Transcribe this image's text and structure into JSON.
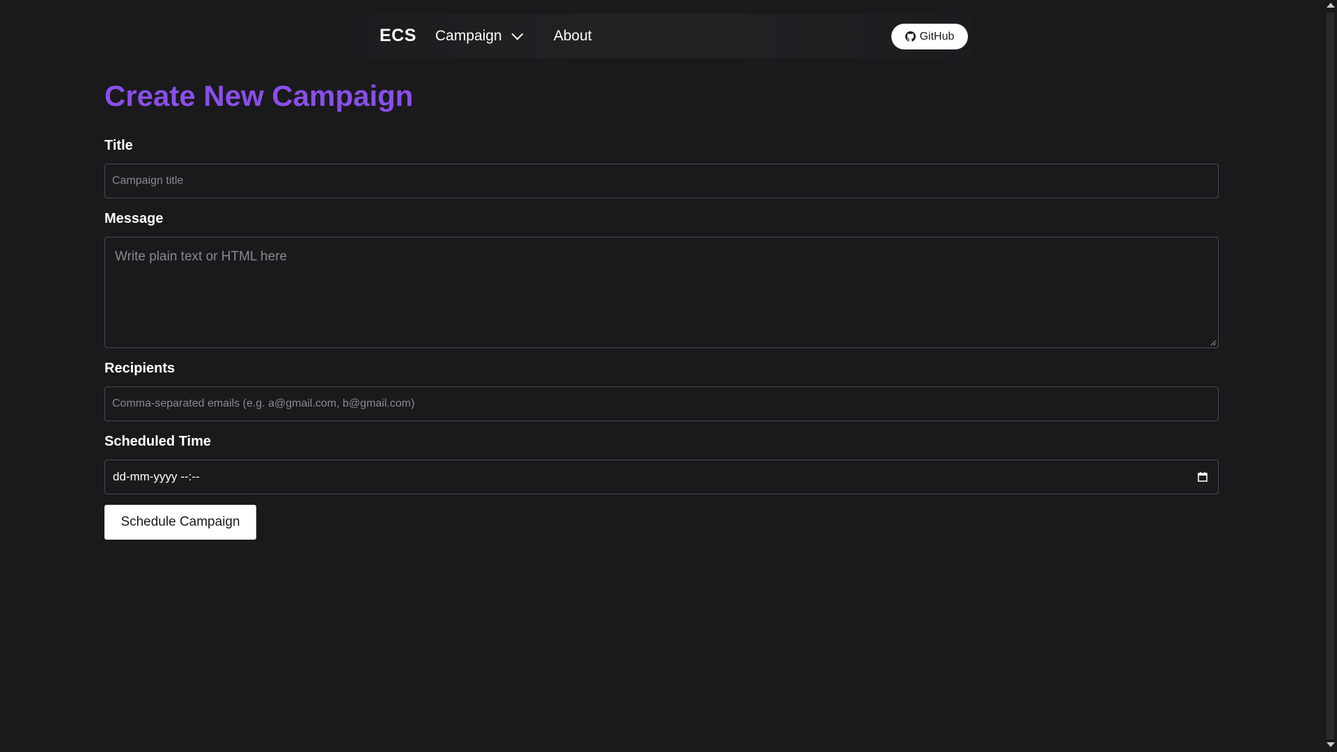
{
  "navbar": {
    "brand": "ECS",
    "campaign_label": "Campaign",
    "about_label": "About",
    "github_label": "GitHub"
  },
  "page": {
    "title": "Create New Campaign"
  },
  "form": {
    "title_label": "Title",
    "title_placeholder": "Campaign title",
    "message_label": "Message",
    "message_placeholder": "Write plain text or HTML here",
    "recipients_label": "Recipients",
    "recipients_placeholder": "Comma-separated emails (e.g. a@gmail.com, b@gmail.com)",
    "scheduled_label": "Scheduled Time",
    "scheduled_value": "dd-mm-yyyy --:--",
    "submit_label": "Schedule Campaign"
  },
  "colors": {
    "background": "#1a1a1d",
    "accent": "#8a4fe8",
    "text": "#ffffff"
  },
  "icons": [
    "chevron-down-icon",
    "github-icon",
    "calendar-icon",
    "resize-grip-icon"
  ]
}
